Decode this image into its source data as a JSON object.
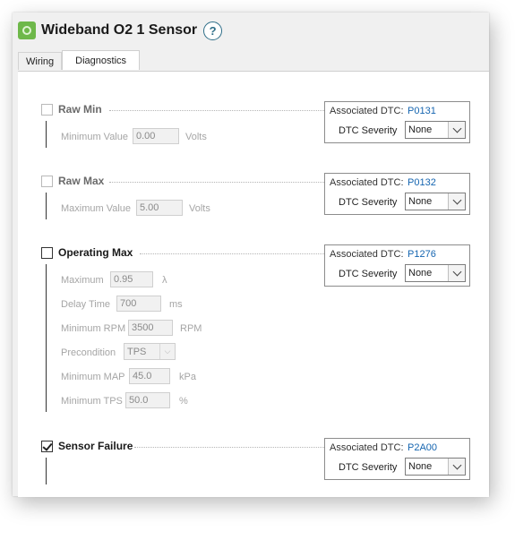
{
  "window": {
    "title": "Wideband O2 1 Sensor",
    "help_label": "?"
  },
  "tabs": [
    {
      "label": "Wiring",
      "active": false
    },
    {
      "label": "Diagnostics",
      "active": true
    }
  ],
  "sections": {
    "raw_min": {
      "title": "Raw Min",
      "checked": false,
      "enabled": false,
      "fields": [
        {
          "label": "Minimum Value",
          "value": "0.00",
          "unit": "Volts"
        }
      ],
      "dtc": {
        "label": "Associated DTC:",
        "code": "P0131",
        "severity_label": "DTC Severity",
        "severity": "None"
      }
    },
    "raw_max": {
      "title": "Raw Max",
      "checked": false,
      "enabled": false,
      "fields": [
        {
          "label": "Maximum Value",
          "value": "5.00",
          "unit": "Volts"
        }
      ],
      "dtc": {
        "label": "Associated DTC:",
        "code": "P0132",
        "severity_label": "DTC Severity",
        "severity": "None"
      }
    },
    "operating_max": {
      "title": "Operating Max",
      "checked": false,
      "enabled": true,
      "fields": [
        {
          "label": "Maximum",
          "value": "0.95",
          "unit": "λ"
        },
        {
          "label": "Delay Time",
          "value": "700",
          "unit": "ms"
        },
        {
          "label": "Minimum RPM",
          "value": "3500",
          "unit": "RPM"
        },
        {
          "label": "Precondition",
          "value": "TPS",
          "unit": ""
        },
        {
          "label": "Minimum MAP",
          "value": "45.0",
          "unit": "kPa"
        },
        {
          "label": "Minimum TPS",
          "value": "50.0",
          "unit": "%"
        }
      ],
      "dtc": {
        "label": "Associated DTC:",
        "code": "P1276",
        "severity_label": "DTC Severity",
        "severity": "None"
      }
    },
    "sensor_failure": {
      "title": "Sensor Failure",
      "checked": true,
      "enabled": true,
      "dtc": {
        "label": "Associated DTC:",
        "code": "P2A00",
        "severity_label": "DTC Severity",
        "severity": "None"
      }
    }
  },
  "colors": {
    "app_icon": "#6eb84a",
    "help_accent": "#2e6e88",
    "dtc_code": "#1565b0",
    "disabled_text": "#a5a5a5"
  },
  "icons": {
    "app": "sensor-app-icon",
    "help": "help-circle-icon",
    "dropdown": "chevron-down-icon",
    "check": "checkmark-icon"
  }
}
